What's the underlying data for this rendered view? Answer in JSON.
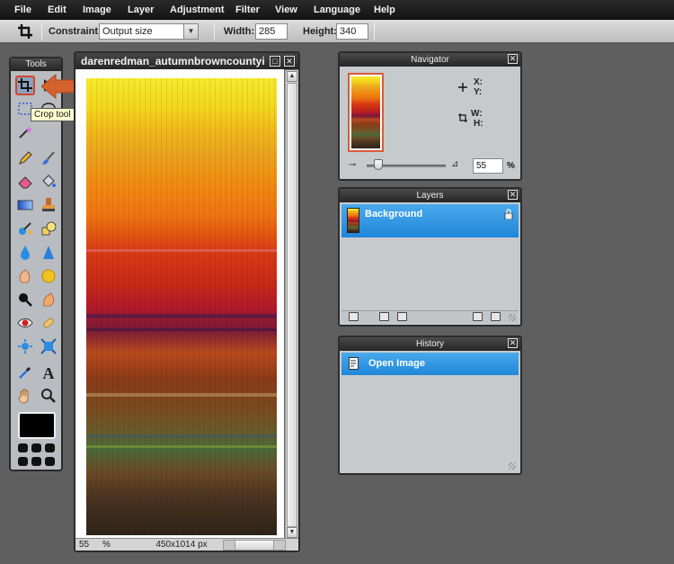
{
  "menubar": {
    "items": [
      "File",
      "Edit",
      "Image",
      "Layer",
      "Adjustment",
      "Filter",
      "View",
      "Language",
      "Help"
    ]
  },
  "options_bar": {
    "constraint_label": "Constraint:",
    "constraint_value": "Output size",
    "width_label": "Width:",
    "width_value": "285",
    "height_label": "Height:",
    "height_value": "340"
  },
  "tools_panel": {
    "title": "Tools",
    "active_tool": "crop-tool",
    "tooltip": "Crop tool (C)",
    "tools": [
      "crop-icon",
      "marquee-icon",
      "lasso-icon",
      "magic-wand-icon",
      "pencil-icon",
      "brush-icon",
      "eraser-icon",
      "paint-bucket-icon",
      "gradient-icon",
      "stamp-icon",
      "color-replace-icon",
      "drawing-icon",
      "blur-icon",
      "sharpen-icon",
      "smudge-icon",
      "sponge-icon",
      "dodge-icon",
      "burn-icon",
      "red-eye-icon",
      "spot-heal-icon",
      "bloat-icon",
      "pinch-icon",
      "color-picker-icon",
      "type-icon",
      "hand-icon",
      "zoom-icon"
    ]
  },
  "image_window": {
    "title": "darenredman_autumnbrowncountyi",
    "zoom": "55",
    "zoom_unit": "%",
    "dimensions": "450x1014 px"
  },
  "navigator": {
    "title": "Navigator",
    "x_label": "X:",
    "y_label": "Y:",
    "w_label": "W:",
    "h_label": "H:",
    "zoom_value": "55",
    "zoom_unit": "%",
    "zoom_level_fraction": 0.1
  },
  "layers": {
    "title": "Layers",
    "items": [
      {
        "name": "Background",
        "locked": true,
        "selected": true
      }
    ]
  },
  "history": {
    "title": "History",
    "items": [
      {
        "name": "Open Image",
        "selected": true
      }
    ]
  },
  "colors": {
    "accent_blue": "#2a93e0",
    "crop_highlight": "#d0452a",
    "arrow": "#d4622e"
  }
}
